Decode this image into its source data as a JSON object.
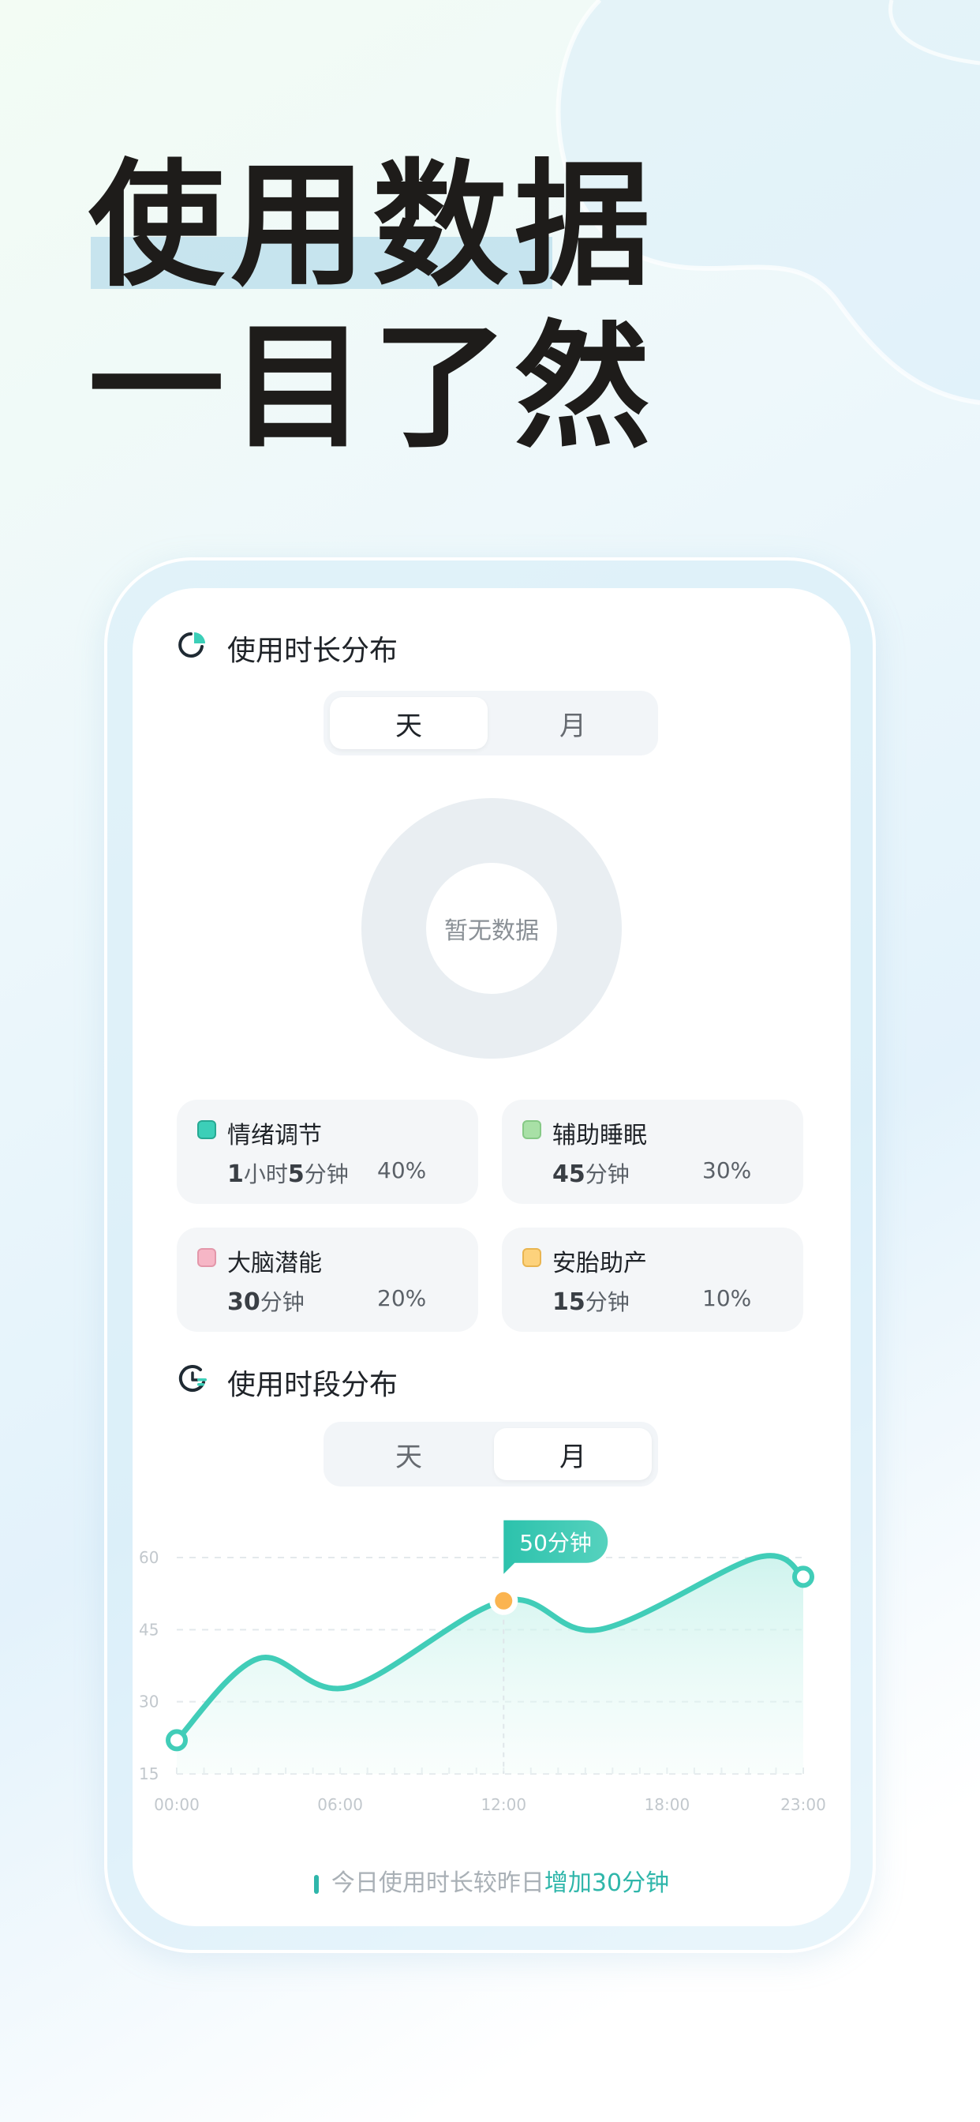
{
  "headline": {
    "line1": "使用数据",
    "line2": "一目了然"
  },
  "section1": {
    "title": "使用时长分布",
    "tabs": [
      {
        "label": "天",
        "active": true
      },
      {
        "label": "月",
        "active": false
      }
    ],
    "donut_empty_text": "暂无数据",
    "legend": [
      {
        "name": "情绪调节",
        "color": "#3ccfb8",
        "dur_parts": [
          {
            "num": "1",
            "unit": "小时"
          },
          {
            "num": "5",
            "unit": "分钟"
          }
        ],
        "percent": "40%"
      },
      {
        "name": "辅助睡眠",
        "color": "#a8e0a6",
        "dur_parts": [
          {
            "num": "45",
            "unit": "分钟"
          }
        ],
        "percent": "30%"
      },
      {
        "name": "大脑潜能",
        "color": "#f6b6c6",
        "dur_parts": [
          {
            "num": "30",
            "unit": "分钟"
          }
        ],
        "percent": "20%"
      },
      {
        "name": "安胎助产",
        "color": "#fdd27c",
        "dur_parts": [
          {
            "num": "15",
            "unit": "分钟"
          }
        ],
        "percent": "10%"
      }
    ]
  },
  "section2": {
    "title": "使用时段分布",
    "tabs": [
      {
        "label": "天",
        "active": false
      },
      {
        "label": "月",
        "active": true
      }
    ],
    "tooltip": "50分钟"
  },
  "chart_data": {
    "type": "line",
    "x": [
      0,
      3,
      6.3,
      12,
      15.5,
      21.3,
      23
    ],
    "y": [
      22,
      39,
      33,
      51,
      45,
      60,
      56
    ],
    "x_tick_labels": [
      "00:00",
      "06:00",
      "12:00",
      "18:00",
      "23:00"
    ],
    "x_ticks": [
      0,
      6,
      12,
      18,
      23
    ],
    "y_ticks": [
      15,
      30,
      45,
      60
    ],
    "ylim": [
      15,
      60
    ],
    "xlim": [
      0,
      23
    ],
    "highlight_index": 3,
    "highlight_label": "50分钟",
    "line_color": "#41cdb8",
    "fill": "area-gradient",
    "grid": "dashed-horizontal"
  },
  "footer": {
    "prefix": "今日使用时长较昨日",
    "highlight": "增加30分钟"
  }
}
